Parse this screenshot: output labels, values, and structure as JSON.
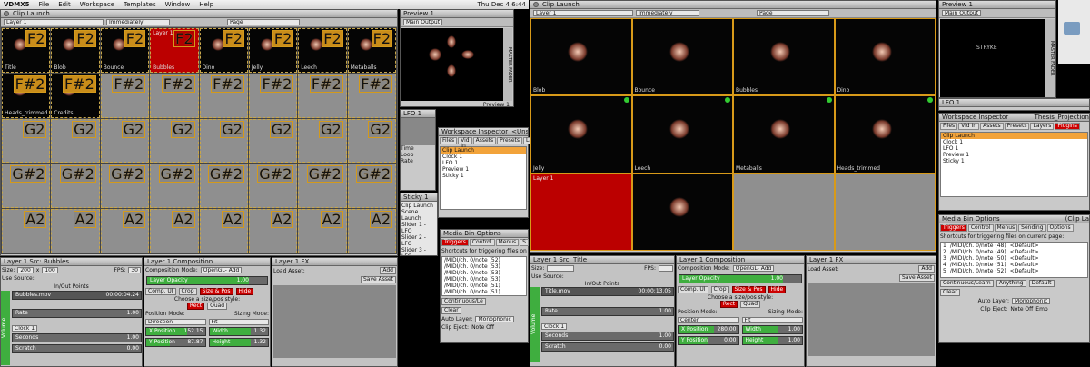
{
  "menubar": {
    "app": "VDMX5",
    "items": [
      "File",
      "Edit",
      "Workspace",
      "Templates",
      "Window",
      "Help"
    ],
    "clock": "Thu Dec 4 6:44"
  },
  "left": {
    "clip_launch": {
      "title": "Clip Launch",
      "layer_sel": "Layer 1",
      "mode_sel": "Immediately",
      "page_sel": "Page"
    },
    "grid": [
      {
        "note": "F2",
        "name": "Title",
        "dark": true
      },
      {
        "note": "F2",
        "name": "Blob",
        "dark": true
      },
      {
        "note": "F2",
        "name": "Bounce",
        "dark": true
      },
      {
        "note": "F2",
        "name": "Bubbles",
        "red": true,
        "top": "Layer 1"
      },
      {
        "note": "F2",
        "name": "Dino",
        "dark": true
      },
      {
        "note": "F2",
        "name": "Jelly",
        "dark": true
      },
      {
        "note": "F2",
        "name": "Leech",
        "dark": true
      },
      {
        "note": "F2",
        "name": "Metaballs",
        "dark": true
      },
      {
        "note": "F#2",
        "name": "Heads_trimmed",
        "dark": true
      },
      {
        "note": "F#2",
        "name": "Credits",
        "dark": true
      },
      {
        "note": "F#2"
      },
      {
        "note": "F#2"
      },
      {
        "note": "F#2"
      },
      {
        "note": "F#2"
      },
      {
        "note": "F#2"
      },
      {
        "note": "F#2"
      },
      {
        "note": "G2"
      },
      {
        "note": "G2"
      },
      {
        "note": "G2"
      },
      {
        "note": "G2"
      },
      {
        "note": "G2"
      },
      {
        "note": "G2"
      },
      {
        "note": "G2"
      },
      {
        "note": "G2"
      },
      {
        "note": "G#2"
      },
      {
        "note": "G#2"
      },
      {
        "note": "G#2"
      },
      {
        "note": "G#2"
      },
      {
        "note": "G#2"
      },
      {
        "note": "G#2"
      },
      {
        "note": "G#2"
      },
      {
        "note": "G#2"
      },
      {
        "note": "A2"
      },
      {
        "note": "A2"
      },
      {
        "note": "A2"
      },
      {
        "note": "A2"
      },
      {
        "note": "A2"
      },
      {
        "note": "A2"
      },
      {
        "note": "A2"
      },
      {
        "note": "A2"
      }
    ],
    "preview": {
      "title": "Preview 1",
      "output": "Main Output",
      "fader": "MASTER FADER",
      "fader_val": "1.00",
      "tab": "Preview 1"
    },
    "lfo": {
      "title": "LFO 1",
      "items": [
        "Time",
        "Loop",
        "Rate"
      ]
    },
    "inspector": {
      "title": "Workspace Inspector",
      "sub": "<Unsa",
      "tabs": [
        "Files",
        "Vid In",
        "Assets",
        "Presets",
        "Lay"
      ],
      "items": [
        "Clip Launch",
        "Clock 1",
        "LFO 1",
        "Preview 1",
        "Sticky 1"
      ]
    },
    "sticky": {
      "title": "Sticky 1",
      "lines": [
        "Clip Launch",
        "Scene Launch",
        "Slider 1 - LFO",
        "Slider 2 - LFO",
        "Slider 3 - LFO",
        "Slider 4 - LFO",
        "Slider 5 - Clo",
        "Master - Lay"
      ]
    },
    "media_bin": {
      "title": "Media Bin Options",
      "tabs": [
        "Triggers",
        "Control",
        "Menus",
        "S"
      ],
      "desc": "Shortcuts for triggering files on current",
      "rows": [
        "/MIDI/ch. 0/note (52)",
        "/MIDI/ch. 0/note (53)",
        "/MIDI/ch. 0/note (53)",
        "/MIDI/ch. 0/note (53)",
        "/MIDI/ch. 0/note (51)",
        "/MIDI/ch. 0/note (51)"
      ],
      "btn": "Continuous/Le",
      "clear": "Clear",
      "autolayer": "Auto Layer:",
      "autolayer_val": "Monophonic",
      "eject": "Clip Eject:",
      "eject_val": "Note Off"
    },
    "src": {
      "title": "Layer 1 Src: Bubbles",
      "size_label": "Size:",
      "size_w": "200",
      "size_x": "x",
      "size_h": "100",
      "fps": "FPS:",
      "fps_val": "30",
      "use_source": "Use Source:",
      "inout": "In/Out Points",
      "file": "Bubbles.mov",
      "time": "00:00:04.24",
      "rate": "Rate",
      "rate_val": "1.00",
      "clock": "Clock 1",
      "seconds": "Seconds",
      "sec_val": "1.00",
      "scratch": "Scratch",
      "scratch_val": "0.00",
      "loop": "Loop",
      "volume": "Volume",
      "vol_val": "1.00"
    },
    "comp": {
      "title": "Layer 1 Composition",
      "mode_label": "Composition Mode:",
      "mode": "OpenGL- Add",
      "opacity": "Layer Opacity",
      "opacity_val": "1.00",
      "hide": "Hide",
      "tabs": [
        "Comp. UI",
        "Crop",
        "Size & Pos"
      ],
      "choose": "Choose a size/pos style:",
      "rect": "Rect",
      "quad": "Quad",
      "pos_mode": "Position Mode:",
      "pos_val": "Direction",
      "sizing": "Sizing Mode:",
      "sizing_val": "Fit",
      "xpos": "X Position",
      "xpos_val": "152.15",
      "ypos": "Y Position",
      "ypos_val": "-87.87",
      "width": "Width",
      "width_val": "1.32",
      "height": "Height",
      "height_val": "1.32"
    },
    "fx": {
      "title": "Layer 1 FX",
      "load": "Load Asset:",
      "add": "Add",
      "save": "Save Asset"
    }
  },
  "right": {
    "clip_launch": {
      "title": "Clip Launch",
      "layer_sel": "Layer 1",
      "mode_sel": "Immediately",
      "page_sel": "Page"
    },
    "grid": [
      {
        "name": "Blob"
      },
      {
        "name": "Bounce"
      },
      {
        "name": "Bubbles"
      },
      {
        "name": "Dino"
      },
      {
        "name": "Jelly",
        "dot": true
      },
      {
        "name": "Leech",
        "dot": true
      },
      {
        "name": "Metaballs",
        "dot": true
      },
      {
        "name": "Heads_trimmed",
        "dot": true
      },
      {
        "name": "",
        "red": true,
        "top": "Layer 1"
      },
      {
        "name": ""
      },
      {
        "name": "",
        "gray": true
      },
      {
        "name": "",
        "gray": true
      }
    ],
    "preview": {
      "title": "Preview 1",
      "output": "Main Output",
      "fader": "MASTER FADER",
      "fader_val": "1.00",
      "overlay": "STRYKE"
    },
    "lfo": {
      "title": "LFO 1"
    },
    "inspector": {
      "title": "Workspace Inspector",
      "sub": "Thesis_Projection",
      "tabs": [
        "Files",
        "Vid In",
        "Assets",
        "Presets",
        "Layers",
        "Plugins"
      ],
      "items": [
        "Clip Launch",
        "Clock 1",
        "LFO 1",
        "Preview 1",
        "Sticky 1"
      ]
    },
    "media_bin": {
      "title": "Media Bin Options",
      "sub": "(Clip La",
      "tabs": [
        "Triggers",
        "Control",
        "Menus",
        "Sending",
        "Options"
      ],
      "desc": "Shortcuts for triggering files on current page:",
      "rows": [
        {
          "num": "1",
          "addr": "/MIDI/ch. 0/note (48)",
          "val": "<Default>"
        },
        {
          "num": "2",
          "addr": "/MIDI/ch. 0/note (49)",
          "val": "<Default>"
        },
        {
          "num": "3",
          "addr": "/MIDI/ch. 0/note (50)",
          "val": "<Default>"
        },
        {
          "num": "4",
          "addr": "/MIDI/ch. 0/note (51)",
          "val": "<Default>"
        },
        {
          "num": "5",
          "addr": "/MIDI/ch. 0/note (52)",
          "val": "<Default>"
        }
      ],
      "btn1": "Continuous/Learn",
      "btn2": "Anything",
      "btn3": "Default",
      "clear": "Clear",
      "autolayer": "Auto Layer:",
      "autolayer_val": "Monophonic",
      "eject": "Clip Eject:",
      "eject_val": "Note Off",
      "eject2": "Emp"
    },
    "src": {
      "title": "Layer 1 Src: Title",
      "size_label": "Size:",
      "fps": "FPS:",
      "use_source": "Use Source:",
      "inout": "In/Out Points",
      "file": "Title.mov",
      "time": "00:00:13.05",
      "rate": "Rate",
      "rate_val": "1.00",
      "clock": "Clock 1",
      "seconds": "Seconds",
      "sec_val": "1.00",
      "scratch": "Scratch",
      "scratch_val": "0.00",
      "loop": "Loop",
      "volume": "Volume",
      "vol_val": "1.00"
    },
    "comp": {
      "title": "Layer 1 Composition",
      "mode_label": "Composition Mode:",
      "mode": "OpenGL- Add",
      "opacity": "Layer Opacity",
      "opacity_val": "1.00",
      "hide": "Hide",
      "tabs": [
        "Comp. UI",
        "Crop",
        "Size & Pos"
      ],
      "choose": "Choose a size/pos style:",
      "rect": "Rect",
      "quad": "Quad",
      "pos_mode": "Position Mode:",
      "pos_val": "Center",
      "sizing": "Sizing Mode:",
      "sizing_val": "Fit",
      "xpos": "X Position",
      "xpos_val": "280.00",
      "ypos": "Y Position",
      "ypos_val": "0.00",
      "width": "Width",
      "width_val": "1.00",
      "height": "Height",
      "height_val": "1.00"
    },
    "fx": {
      "title": "Layer 1 FX",
      "load": "Load Asset:",
      "add": "Add",
      "save": "Save Asset"
    }
  }
}
